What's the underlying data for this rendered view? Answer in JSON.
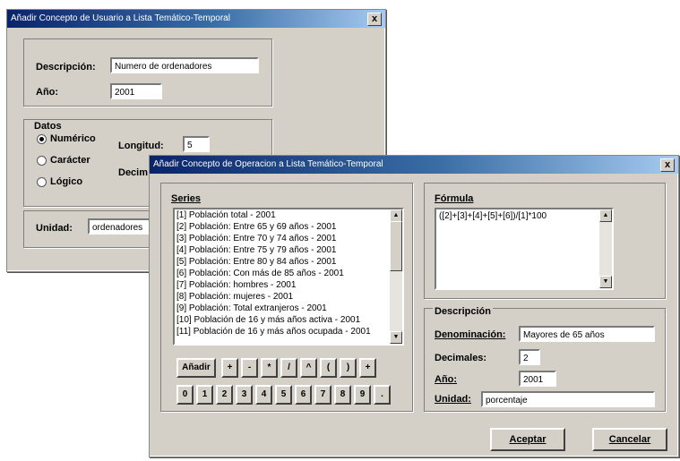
{
  "back_dialog": {
    "title": "Añadir Concepto de Usuario a Lista Temático-Temporal",
    "close": "x",
    "descripcion_label": "Descripción:",
    "descripcion_value": "Numero de ordenadores",
    "anio_label": "Año:",
    "anio_value": "2001",
    "datos_label": "Datos",
    "radio_numerico": "Numérico",
    "radio_caracter": "Carácter",
    "radio_logico": "Lógico",
    "longitud_label": "Longitud:",
    "longitud_value": "5",
    "decimales_label": "Decim",
    "unidad_label": "Unidad:",
    "unidad_value": "ordenadores"
  },
  "front_dialog": {
    "title": "Añadir Concepto de Operacion a Lista Temático-Temporal",
    "close": "x",
    "series_label": "Series",
    "series": [
      "[1] Población total - 2001",
      "[2] Población: Entre 65 y 69 años - 2001",
      "[3] Población: Entre 70 y 74 años - 2001",
      "[4] Población: Entre 75 y 79 años - 2001",
      "[5] Población: Entre 80 y 84 años - 2001",
      "[6] Población: Con más de 85 años - 2001",
      "[7] Población: hombres - 2001",
      "[8] Población: mujeres - 2001",
      "[9] Población: Total extranjeros - 2001",
      "[10] Población de 16 y más años activa - 2001",
      "[11] Población de 16 y más años ocupada - 2001"
    ],
    "add_button": "Añadir",
    "operators": [
      "+",
      "-",
      "*",
      "/",
      "^",
      "(",
      ")",
      "+"
    ],
    "digits": [
      "0",
      "1",
      "2",
      "3",
      "4",
      "5",
      "6",
      "7",
      "8",
      "9",
      "."
    ],
    "formula_label": "Fórmula",
    "formula_value": "([2]+[3]+[4]+[5]+[6])/[1]*100",
    "descripcion_group_label": "Descripción",
    "denominacion_label": "Denominación:",
    "denominacion_value": "Mayores de 65 años",
    "decimales_label": "Decimales:",
    "decimales_value": "2",
    "anio_label": "Año:",
    "anio_value": "2001",
    "unidad_label": "Unidad:",
    "unidad_value": "porcentaje",
    "aceptar_button": "Aceptar",
    "cancelar_button": "Cancelar"
  }
}
